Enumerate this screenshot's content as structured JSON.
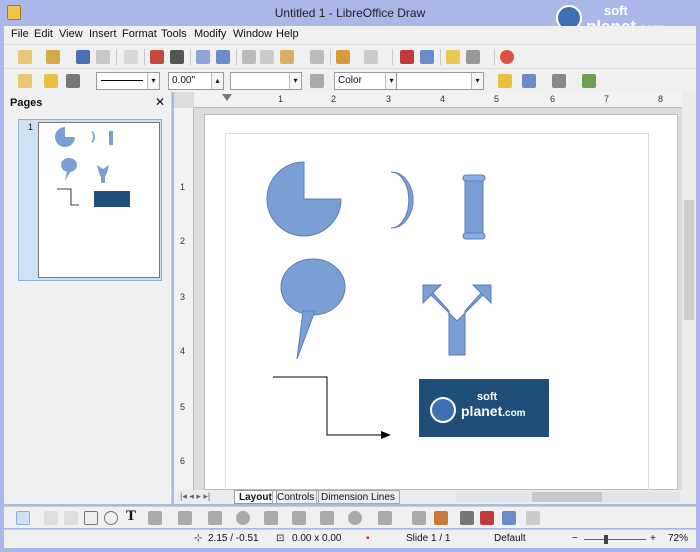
{
  "window": {
    "title": "Untitled 1 - LibreOffice Draw"
  },
  "watermark": {
    "line1": "soft",
    "line2": "planet",
    "suffix": ".com"
  },
  "menu": [
    "File",
    "Edit",
    "View",
    "Insert",
    "Format",
    "Tools",
    "Modify",
    "Window",
    "Help"
  ],
  "toolbar2": {
    "line_width": "0.00\"",
    "area_style": "Color"
  },
  "pages_panel": {
    "title": "Pages",
    "close": "✕",
    "slide_number": "1"
  },
  "ruler": {
    "h": [
      "1",
      "2",
      "3",
      "4",
      "5",
      "6",
      "7",
      "8"
    ],
    "v": [
      "1",
      "2",
      "3",
      "4",
      "5",
      "6"
    ]
  },
  "tabs": [
    "Layout",
    "Controls",
    "Dimension Lines"
  ],
  "statusbar": {
    "position": "2.15 / -0.51",
    "size": "0.00 x 0.00",
    "slide": "Slide 1 / 1",
    "layout": "Default",
    "zoom": "72%"
  },
  "colors": {
    "shape_fill": "#7a9fd4",
    "shape_stroke": "#5b7fb8",
    "window_frame": "#aab7e8"
  }
}
